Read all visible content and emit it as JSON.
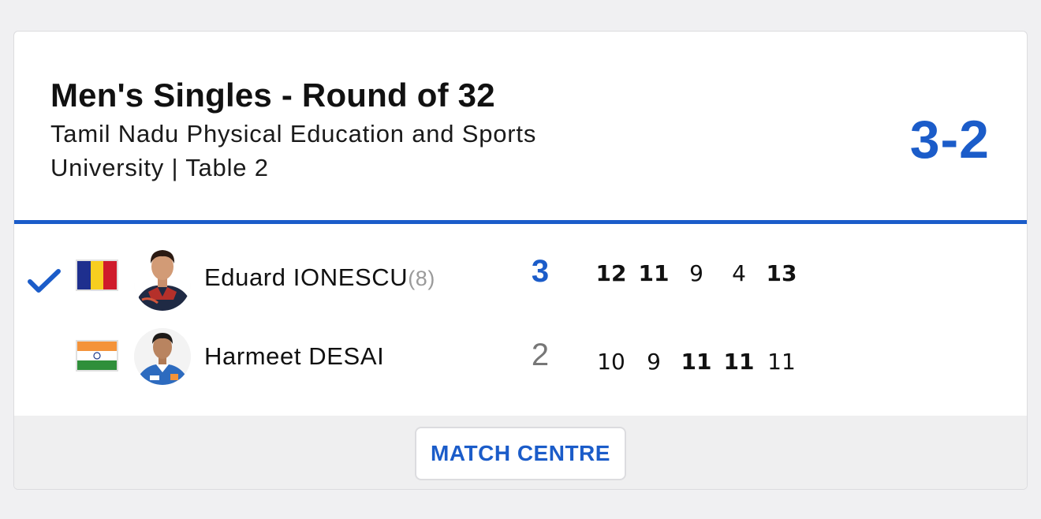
{
  "match": {
    "title": "Men's Singles - Round of 32",
    "venue": "Tamil Nadu Physical Education and Sports University | Table 2",
    "overall_score": "3-2"
  },
  "players": [
    {
      "name": "Eduard IONESCU",
      "seed": "(8)",
      "country_flag": "romania-flag",
      "games_won": "3",
      "winner": true,
      "sets": [
        {
          "score": "12",
          "won": true
        },
        {
          "score": "11",
          "won": true
        },
        {
          "score": "9",
          "won": false
        },
        {
          "score": "4",
          "won": false
        },
        {
          "score": "13",
          "won": true
        }
      ]
    },
    {
      "name": "Harmeet DESAI",
      "seed": "",
      "country_flag": "india-flag",
      "games_won": "2",
      "winner": false,
      "sets": [
        {
          "score": "10",
          "won": false
        },
        {
          "score": "9",
          "won": false
        },
        {
          "score": "11",
          "won": true
        },
        {
          "score": "11",
          "won": true
        },
        {
          "score": "11",
          "won": false
        }
      ]
    }
  ],
  "footer": {
    "button_label": "MATCH CENTRE"
  },
  "colors": {
    "accent": "#1b5cc9",
    "loser_score": "#777777",
    "seed": "#9a9a9a"
  }
}
